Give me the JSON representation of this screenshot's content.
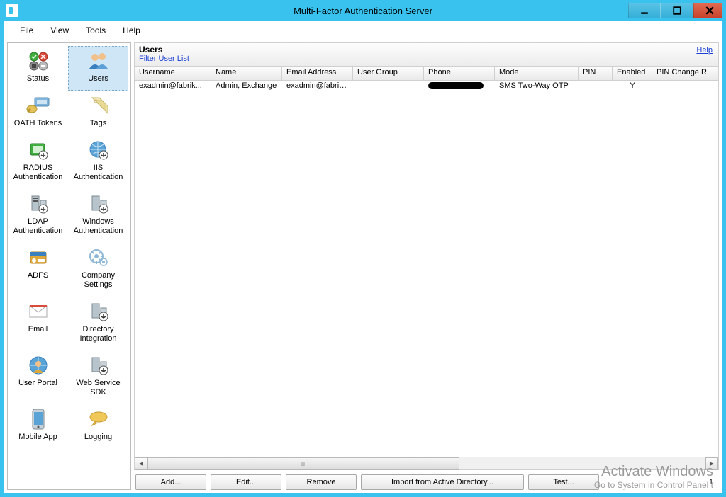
{
  "window": {
    "title": "Multi-Factor Authentication Server"
  },
  "menubar": {
    "file": "File",
    "view": "View",
    "tools": "Tools",
    "help": "Help"
  },
  "sidebar": {
    "items": [
      {
        "label": "Status"
      },
      {
        "label": "Users"
      },
      {
        "label": "OATH Tokens"
      },
      {
        "label": "Tags"
      },
      {
        "label": "RADIUS Authentication"
      },
      {
        "label": "IIS Authentication"
      },
      {
        "label": "LDAP Authentication"
      },
      {
        "label": "Windows Authentication"
      },
      {
        "label": "ADFS"
      },
      {
        "label": "Company Settings"
      },
      {
        "label": "Email"
      },
      {
        "label": "Directory Integration"
      },
      {
        "label": "User Portal"
      },
      {
        "label": "Web Service SDK"
      },
      {
        "label": "Mobile App"
      },
      {
        "label": "Logging"
      }
    ]
  },
  "panel": {
    "title": "Users",
    "filter_link": "Filter User List",
    "help_link": "Help",
    "columns": {
      "username": "Username",
      "name": "Name",
      "email": "Email Address",
      "group": "User Group",
      "phone": "Phone",
      "mode": "Mode",
      "pin": "PIN",
      "enabled": "Enabled",
      "pinchange": "PIN Change R"
    },
    "rows": [
      {
        "username": "exadmin@fabrik...",
        "name": "Admin, Exchange",
        "email": "exadmin@fabrik...",
        "group": "",
        "phone_redacted": true,
        "mode": "SMS Two-Way OTP",
        "pin": "",
        "enabled": "Y",
        "pinchange": ""
      }
    ],
    "count": "1"
  },
  "buttons": {
    "add": "Add...",
    "edit": "Edit...",
    "remove": "Remove",
    "import": "Import from Active Directory...",
    "test": "Test..."
  },
  "watermark": {
    "line1": "Activate Windows",
    "line2": "Go to System in Control Panel t"
  }
}
